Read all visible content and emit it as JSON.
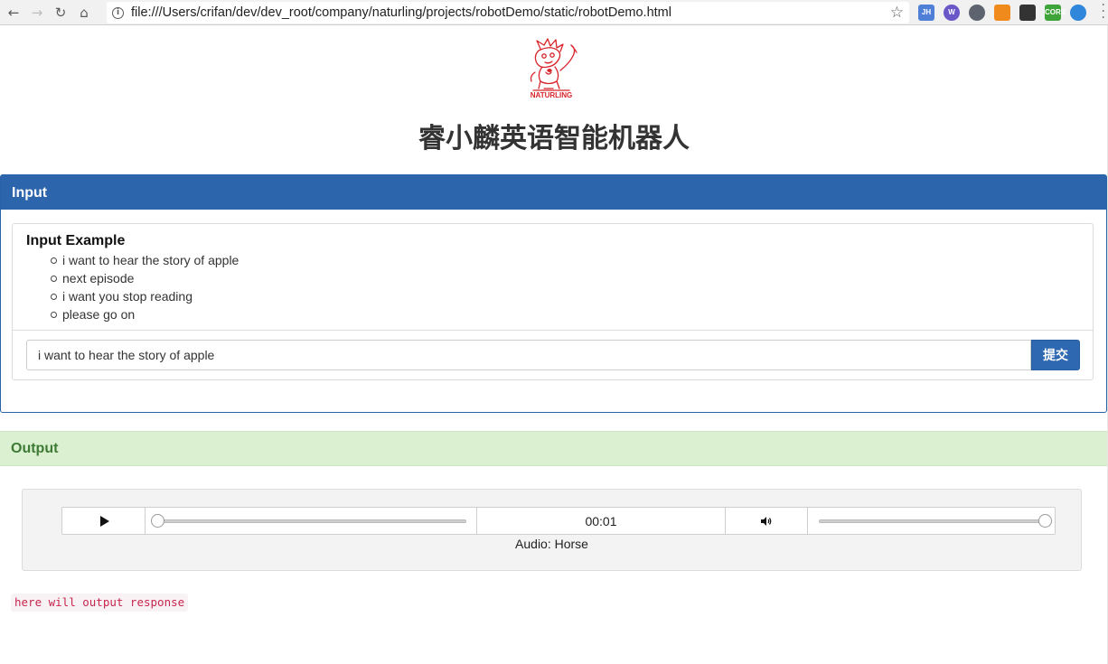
{
  "browser": {
    "url": "file:///Users/crifan/dev/dev_root/company/naturling/projects/robotDemo/static/robotDemo.html",
    "extensions": [
      {
        "name": "jh-extension-icon",
        "label": "JH",
        "color": "#4f7fd6"
      },
      {
        "name": "wappalyzer-icon",
        "label": "W",
        "color": "#6a58c9"
      },
      {
        "name": "react-devtools-icon",
        "label": "",
        "color": "#5d6470"
      },
      {
        "name": "mixed-content-icon",
        "label": "",
        "color": "#f08a1c"
      },
      {
        "name": "qr-code-icon",
        "label": "",
        "color": "#333333"
      },
      {
        "name": "cors-icon",
        "label": "CORS",
        "color": "#3ea43a"
      },
      {
        "name": "globe-extension-icon",
        "label": "",
        "color": "#2f86db"
      }
    ]
  },
  "logo": {
    "text": "NATURLING",
    "color": "#d8232a"
  },
  "page_title": "睿小麟英语智能机器人",
  "input_panel": {
    "heading": "Input",
    "example_title": "Input Example",
    "examples": [
      "i want to hear the story of apple",
      "next episode",
      "i want you stop reading",
      "please go on"
    ],
    "input_value": "i want to hear the story of apple",
    "submit_label": "提交"
  },
  "output_panel": {
    "heading": "Output",
    "audio": {
      "time": "00:01",
      "progress": 0.0,
      "volume": 1.0,
      "caption": "Audio: Horse"
    },
    "response_text": "here will output response"
  },
  "colors": {
    "primary": "#2c65ab",
    "success_bg": "#dbf0d0",
    "success_text": "#3d7a35",
    "code_text": "#c7254e"
  }
}
